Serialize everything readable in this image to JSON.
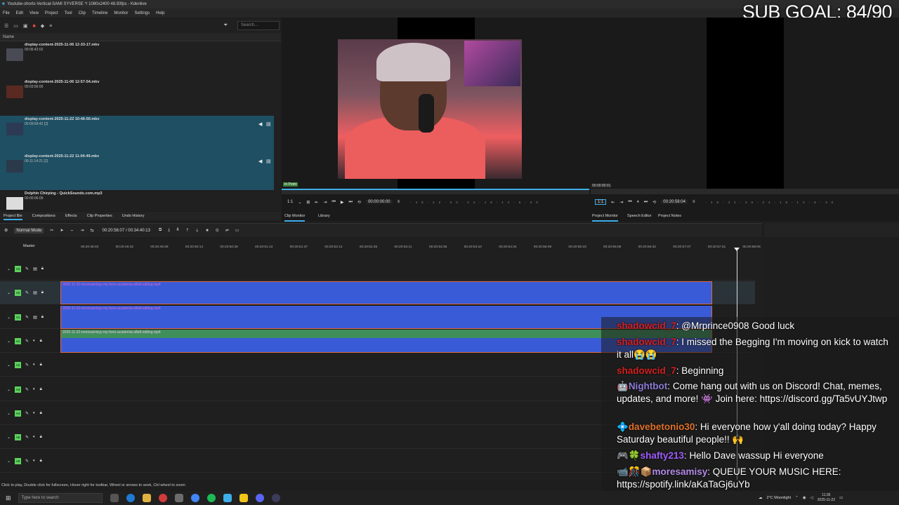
{
  "window": {
    "title": "Youtube-shorts-Vertical-SAMI SYVERSE */ 1080x2400 48.93fps - Kdenlive"
  },
  "menu": [
    "File",
    "Edit",
    "View",
    "Project",
    "Tool",
    "Clip",
    "Timeline",
    "Monitor",
    "Settings",
    "Help"
  ],
  "overlay": {
    "sub_goal": "SUB GOAL: 84/90"
  },
  "bin": {
    "search_placeholder": "Search...",
    "header": "Name",
    "clips": [
      {
        "name": "display-content-2025-11-06 12-33-17.mkv",
        "duration": "00:06:42:02",
        "selected": false
      },
      {
        "name": "display-content-2025-11-06 12-57-54.mkv",
        "duration": "00:03:56:00",
        "selected": false
      },
      {
        "name": "display-content-2025-11-22 10-46-50.mkv",
        "duration": "00:09:59:42 [2]",
        "selected": true
      },
      {
        "name": "display-content-2025-11-22 11-04-49.mkv",
        "duration": "00:11:14:21 [2]",
        "selected": true
      },
      {
        "name": "Dolphin Chirping - QuickSounds.com.mp3",
        "duration": "00:00:06:09",
        "selected": false
      }
    ],
    "tabs": [
      "Project Bin",
      "Compositions",
      "Effects",
      "Clip Properties",
      "Undo History"
    ]
  },
  "clip_monitor": {
    "in_point_label": "In Point",
    "zoom": "1:1",
    "timecode": "00:00:00:00",
    "meter_ticks": [
      "-48",
      "-42",
      "-30",
      "-24",
      "-18",
      "-12",
      "-6",
      "-3",
      "0"
    ]
  },
  "project_monitor": {
    "zoom": "1:1",
    "position_tc": "00:00:00:01",
    "timecode": "00:20:58:04",
    "meter_ticks": [
      "-48",
      "-42",
      "-30",
      "-24",
      "-18",
      "-12",
      "-6",
      "-3",
      "0"
    ]
  },
  "monitor_tabs": {
    "clip_monitor": "Clip Monitor",
    "library": "Library",
    "project_monitor": "Project Monitor",
    "speech_editor": "Speech Editor",
    "project_notes": "Project Notes"
  },
  "timeline": {
    "mode": "Normal Mode",
    "timecode": "00:20:56:07 / 00:34:40:13",
    "master_label": "Master",
    "ruler": [
      "00:20:48:40",
      "00:20:49:15",
      "00:20:49:39",
      "00:20:50:14",
      "00:20:50:38",
      "00:20:51:13",
      "00:20:51:37",
      "00:20:52:12",
      "00:20:52:36",
      "00:20:53:11",
      "00:20:53:35",
      "00:20:54:10",
      "00:20:54:34",
      "00:20:55:09",
      "00:20:55:33",
      "00:20:56:08",
      "00:20:56:32",
      "00:20:57:07",
      "00:20:57:31",
      "00:20:58:06"
    ],
    "tracks": [
      "V3",
      "V2",
      "V1",
      "A1",
      "A2",
      "A3",
      "A4",
      "A5",
      "A6"
    ],
    "clip_label": "2025-11-22-moresamisyy-my-hero-academia-s8e8-editing.mp4"
  },
  "status": {
    "hint": "Click to play, Double click for fullscreen, Hover right for toolbar, Wheel or arrows to seek, Ctrl wheel to zoom"
  },
  "chat": [
    {
      "badges": "",
      "user": "shadowcid_7",
      "user_color": "#d32020",
      "text": "@Mrprince0908 Good luck"
    },
    {
      "badges": "",
      "user": "shadowcid_7",
      "user_color": "#d32020",
      "text": "I missed the Begging I'm moving on kick to watch it all😭😭"
    },
    {
      "badges": "",
      "user": "shadowcid_7",
      "user_color": "#d32020",
      "text": "Beginning"
    },
    {
      "badges": "🤖",
      "user": "Nightbot",
      "user_color": "#8c7bd6",
      "text": "Come hang out with us on Discord! Chat, memes, updates, and more! 👾 Join here: https://discord.gg/Ta5vUYJtwp"
    },
    {
      "badges": "💠",
      "user": "davebetonio30",
      "user_color": "#e0712a",
      "text": "Hi everyone how y'all doing today? Happy Saturday beautiful people!! 🙌"
    },
    {
      "badges": "🎮🍀",
      "user": "shafty213",
      "user_color": "#a05cff",
      "text": "Hello Dave wassup Hi everyone"
    },
    {
      "badges": "📹🎊📦",
      "user": "moresamisy",
      "user_color": "#b48be8",
      "text": "QUEUE YOUR MUSIC HERE: https://spotify.link/aKaTaGj6uYb"
    }
  ],
  "taskbar": {
    "search_placeholder": "Type here to search",
    "weather": "2°C Moonlight",
    "time": "11:35",
    "date": "2025-11-22"
  }
}
